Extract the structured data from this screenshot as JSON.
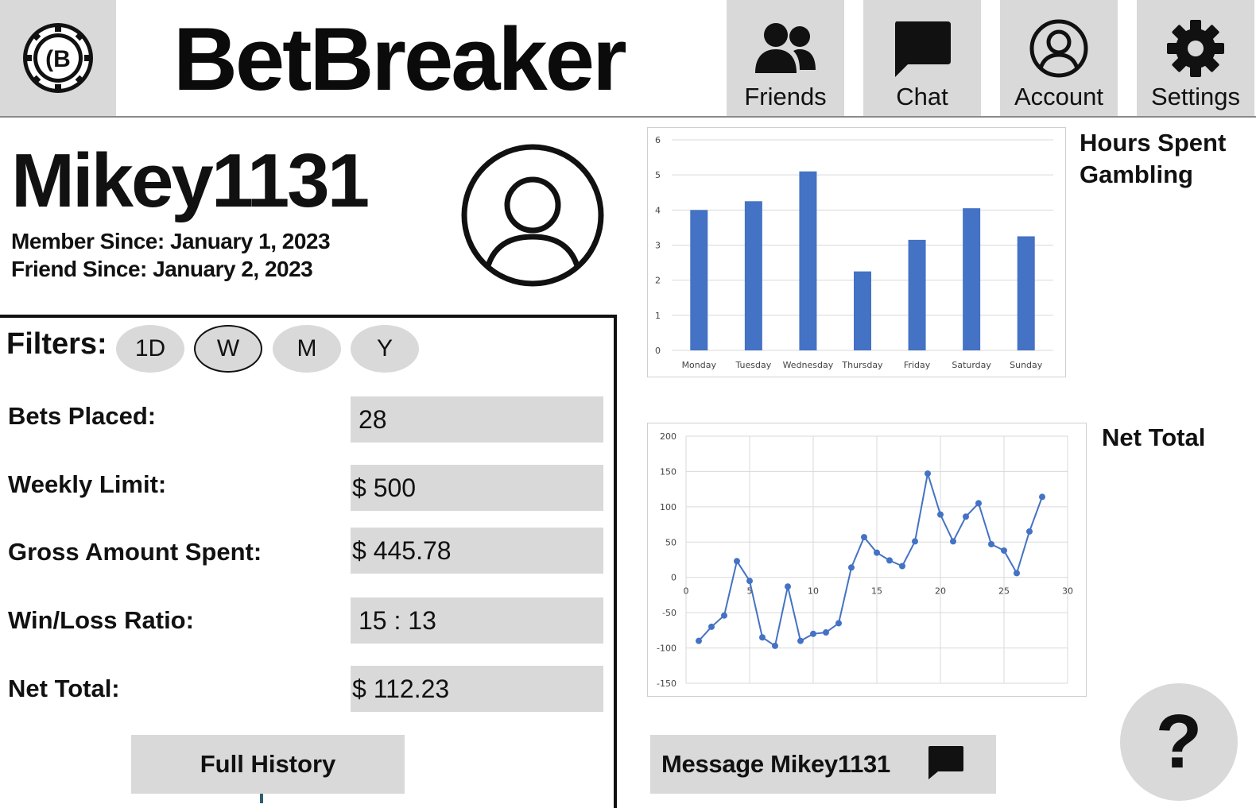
{
  "app": {
    "title": "BetBreaker",
    "logo_icon": "poker-chip-logo-icon"
  },
  "nav": [
    {
      "label": "Friends",
      "icon": "friends-icon"
    },
    {
      "label": "Chat",
      "icon": "chat-icon"
    },
    {
      "label": "Account",
      "icon": "account-icon"
    },
    {
      "label": "Settings",
      "icon": "gear-icon"
    }
  ],
  "profile": {
    "username": "Mikey1131",
    "member_since": "Member Since: January 1, 2023",
    "friend_since": "Friend Since: January 2, 2023",
    "avatar_icon": "user-avatar-icon"
  },
  "filters": {
    "label": "Filters:",
    "options": [
      "1D",
      "W",
      "M",
      "Y"
    ],
    "selected": "W"
  },
  "stats": [
    {
      "label": "Bets Placed:",
      "value": "28"
    },
    {
      "label": "Weekly Limit:",
      "value": "$ 500"
    },
    {
      "label": "Gross Amount Spent:",
      "value": "$ 445.78"
    },
    {
      "label": "Win/Loss Ratio:",
      "value": "15 : 13"
    },
    {
      "label": "Net Total:",
      "value": "$ 112.23"
    }
  ],
  "actions": {
    "full_history": "Full History",
    "message": "Message Mikey1131",
    "help": "?"
  },
  "colors": {
    "panel_gray": "#d9d9d9",
    "series_blue": "#4472c4",
    "text": "#111111"
  },
  "chart_data": [
    {
      "type": "bar",
      "title": "Hours Spent Gambling",
      "categories": [
        "Monday",
        "Tuesday",
        "Wednesday",
        "Thursday",
        "Friday",
        "Saturday",
        "Sunday"
      ],
      "values": [
        4.0,
        4.25,
        5.1,
        2.25,
        3.15,
        4.05,
        3.25
      ],
      "yticks": [
        "0",
        "1",
        "2",
        "3",
        "4",
        "5",
        "6"
      ],
      "ylim": [
        0,
        6
      ],
      "grid": true
    },
    {
      "type": "line",
      "title": "Net Total",
      "x": [
        1,
        2,
        3,
        4,
        5,
        6,
        7,
        8,
        9,
        10,
        11,
        12,
        13,
        14,
        15,
        16,
        17,
        18,
        19,
        20,
        21,
        22,
        23,
        24,
        25,
        26,
        27,
        28
      ],
      "values": [
        -90,
        -70,
        -54,
        23,
        -5,
        -85,
        -97,
        -13,
        -90,
        -80,
        -78,
        -65,
        14,
        57,
        35,
        24,
        16,
        51,
        147,
        89,
        51,
        86,
        105,
        47,
        38,
        6,
        65,
        114
      ],
      "xticks": [
        "0",
        "5",
        "10",
        "15",
        "20",
        "25",
        "30"
      ],
      "yticks": [
        "200",
        "150",
        "100",
        "50",
        "0",
        "-50",
        "-100",
        "-150"
      ],
      "xlim": [
        0,
        30
      ],
      "ylim": [
        -150,
        200
      ],
      "grid": true,
      "markers": true
    }
  ]
}
